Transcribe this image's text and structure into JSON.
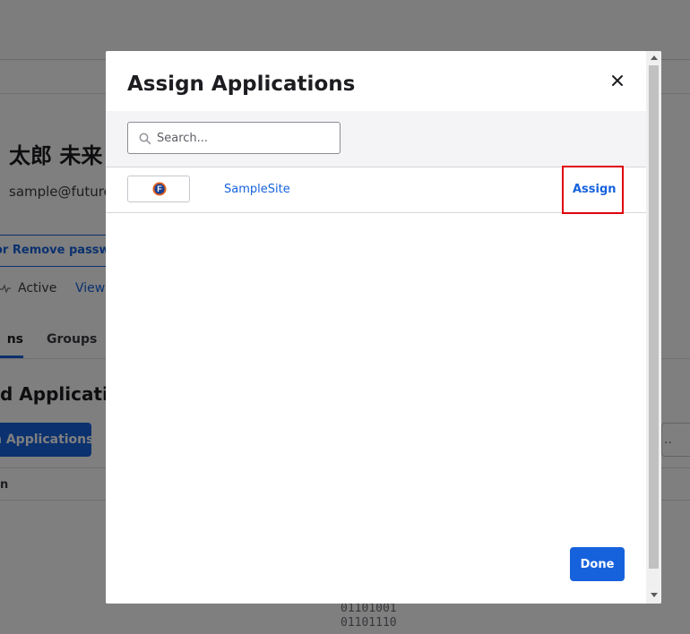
{
  "background": {
    "user_name": "太郎 未来",
    "user_email": "sample@future",
    "password_button": "or Remove passwo",
    "status": "Active",
    "view_link": "View",
    "tabs": [
      "ns",
      "Groups"
    ],
    "section_title": "d Applicatio",
    "assign_button": "n Applications",
    "right_control": "..",
    "column_header": "n",
    "binary_text": "01101001\n01101110"
  },
  "modal": {
    "title": "Assign Applications",
    "close_icon": "close-icon",
    "search": {
      "placeholder": "Search...",
      "value": "",
      "icon": "search-icon"
    },
    "apps": [
      {
        "logo_letter": "F",
        "name": "SampleSite",
        "action": "Assign"
      }
    ],
    "done_label": "Done"
  },
  "colors": {
    "accent": "#1662dd",
    "highlight": "#e0000b",
    "logo_ring": "#e0601f",
    "logo_fill": "#1a3f8f"
  }
}
